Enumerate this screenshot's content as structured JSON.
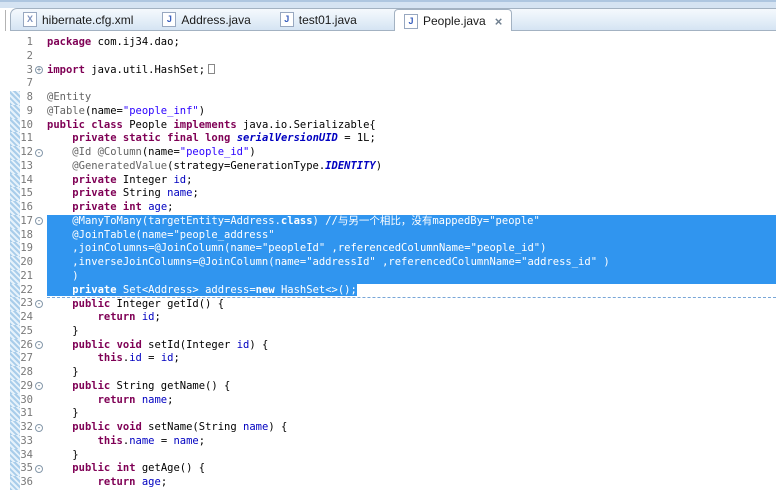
{
  "tabs": [
    {
      "label": "hibernate.cfg.xml",
      "icon": "xml-file-icon",
      "icon_letter": "X",
      "active": false
    },
    {
      "label": "Address.java",
      "icon": "java-file-icon",
      "icon_letter": "J",
      "active": false
    },
    {
      "label": "test01.java",
      "icon": "java-file-icon",
      "icon_letter": "J",
      "active": false
    },
    {
      "label": "People.java",
      "icon": "java-file-icon",
      "icon_letter": "J",
      "active": true,
      "close_glyph": "×"
    }
  ],
  "editor": {
    "colors": {
      "selection": "#3095ef",
      "keyword": "#7f0055",
      "annotation": "#646464",
      "string": "#2a00ff",
      "field": "#0000c0",
      "comment": "#3f7f5f",
      "line_number": "#787878"
    },
    "fold_glyphs": {
      "plus": "+",
      "minus": "-"
    },
    "lines": [
      {
        "n": "1",
        "fold": null,
        "sel": null,
        "tokens": [
          [
            "kw",
            "package"
          ],
          [
            "pl",
            " com.ij34.dao;"
          ]
        ]
      },
      {
        "n": "2",
        "fold": null,
        "sel": null,
        "tokens": []
      },
      {
        "n": "3",
        "fold": "plus",
        "sel": null,
        "tokens": [
          [
            "kw",
            "import"
          ],
          [
            "pl",
            " java.util.HashSet;"
          ],
          [
            "box",
            ""
          ]
        ]
      },
      {
        "n": "7",
        "fold": null,
        "sel": null,
        "tokens": []
      },
      {
        "n": "8",
        "fold": null,
        "sel": null,
        "tokens": [
          [
            "ann",
            "@Entity"
          ]
        ]
      },
      {
        "n": "9",
        "fold": null,
        "sel": null,
        "tokens": [
          [
            "ann",
            "@Table"
          ],
          [
            "pl",
            "(name="
          ],
          [
            "str",
            "\"people_inf\""
          ],
          [
            "pl",
            ")"
          ]
        ]
      },
      {
        "n": "10",
        "fold": null,
        "sel": null,
        "tokens": [
          [
            "kw",
            "public"
          ],
          [
            "pl",
            " "
          ],
          [
            "kw",
            "class"
          ],
          [
            "pl",
            " People "
          ],
          [
            "kw",
            "implements"
          ],
          [
            "pl",
            " java.io.Serializable{"
          ]
        ]
      },
      {
        "n": "11",
        "fold": null,
        "sel": null,
        "tokens": [
          [
            "pl",
            "    "
          ],
          [
            "kw",
            "private"
          ],
          [
            "pl",
            " "
          ],
          [
            "kw",
            "static"
          ],
          [
            "pl",
            " "
          ],
          [
            "kw",
            "final"
          ],
          [
            "pl",
            " "
          ],
          [
            "kw",
            "long"
          ],
          [
            "pl",
            " "
          ],
          [
            "sf",
            "serialVersionUID"
          ],
          [
            "pl",
            " = 1L;"
          ]
        ]
      },
      {
        "n": "12",
        "fold": "minus",
        "sel": null,
        "tokens": [
          [
            "pl",
            "    "
          ],
          [
            "ann",
            "@Id @Column"
          ],
          [
            "pl",
            "(name="
          ],
          [
            "str",
            "\"people_id\""
          ],
          [
            "pl",
            ")"
          ]
        ]
      },
      {
        "n": "13",
        "fold": null,
        "sel": null,
        "tokens": [
          [
            "pl",
            "    "
          ],
          [
            "ann",
            "@GeneratedValue"
          ],
          [
            "pl",
            "(strategy=GenerationType."
          ],
          [
            "sf",
            "IDENTITY"
          ],
          [
            "pl",
            ")"
          ]
        ]
      },
      {
        "n": "14",
        "fold": null,
        "sel": null,
        "tokens": [
          [
            "pl",
            "    "
          ],
          [
            "kw",
            "private"
          ],
          [
            "pl",
            " Integer "
          ],
          [
            "fld",
            "id"
          ],
          [
            "pl",
            ";"
          ]
        ]
      },
      {
        "n": "15",
        "fold": null,
        "sel": null,
        "tokens": [
          [
            "pl",
            "    "
          ],
          [
            "kw",
            "private"
          ],
          [
            "pl",
            " String "
          ],
          [
            "fld",
            "name"
          ],
          [
            "pl",
            ";"
          ]
        ]
      },
      {
        "n": "16",
        "fold": null,
        "sel": null,
        "tokens": [
          [
            "pl",
            "    "
          ],
          [
            "kw",
            "private"
          ],
          [
            "pl",
            " "
          ],
          [
            "kw",
            "int"
          ],
          [
            "pl",
            " "
          ],
          [
            "fld",
            "age"
          ],
          [
            "pl",
            ";"
          ]
        ]
      },
      {
        "n": "17",
        "fold": "minus",
        "sel": "full",
        "tokens": [
          [
            "pl",
            "    "
          ],
          [
            "ann",
            "@ManyToMany"
          ],
          [
            "pl",
            "(targetEntity=Address."
          ],
          [
            "kw",
            "class"
          ],
          [
            "pl",
            ") "
          ],
          [
            "cm",
            "//与另一个相比，没有mappedBy=\"people\""
          ]
        ]
      },
      {
        "n": "18",
        "fold": null,
        "sel": "full",
        "tokens": [
          [
            "pl",
            "    "
          ],
          [
            "ann",
            "@JoinTable"
          ],
          [
            "pl",
            "(name="
          ],
          [
            "str",
            "\"people_address\""
          ]
        ]
      },
      {
        "n": "19",
        "fold": null,
        "sel": "full",
        "tokens": [
          [
            "pl",
            "    ,joinColumns="
          ],
          [
            "ann",
            "@JoinColumn"
          ],
          [
            "pl",
            "(name="
          ],
          [
            "str",
            "\"peopleId\""
          ],
          [
            "pl",
            " ,referencedColumnName="
          ],
          [
            "str",
            "\"people_id\""
          ],
          [
            "pl",
            ")"
          ]
        ]
      },
      {
        "n": "20",
        "fold": null,
        "sel": "full",
        "tokens": [
          [
            "pl",
            "    ,inverseJoinColumns="
          ],
          [
            "ann",
            "@JoinColumn"
          ],
          [
            "pl",
            "(name="
          ],
          [
            "str",
            "\"addressId\""
          ],
          [
            "pl",
            " ,referencedColumnName="
          ],
          [
            "str",
            "\"address_id\""
          ],
          [
            "pl",
            " )"
          ]
        ]
      },
      {
        "n": "21",
        "fold": null,
        "sel": "full",
        "tokens": [
          [
            "pl",
            "    )"
          ]
        ]
      },
      {
        "n": "22",
        "fold": null,
        "sel": "text",
        "tokens": [
          [
            "pl",
            "    "
          ],
          [
            "kw",
            "private"
          ],
          [
            "pl",
            " Set<Address> "
          ],
          [
            "fld",
            "address"
          ],
          [
            "pl",
            "="
          ],
          [
            "kw",
            "new"
          ],
          [
            "pl",
            " HashSet<>();"
          ]
        ]
      },
      {
        "n": "23",
        "fold": "minus",
        "sel": null,
        "tokens": [
          [
            "pl",
            "    "
          ],
          [
            "kw",
            "public"
          ],
          [
            "pl",
            " Integer getId() {"
          ]
        ]
      },
      {
        "n": "24",
        "fold": null,
        "sel": null,
        "tokens": [
          [
            "pl",
            "        "
          ],
          [
            "kw",
            "return"
          ],
          [
            "pl",
            " "
          ],
          [
            "fld",
            "id"
          ],
          [
            "pl",
            ";"
          ]
        ]
      },
      {
        "n": "25",
        "fold": null,
        "sel": null,
        "tokens": [
          [
            "pl",
            "    }"
          ]
        ]
      },
      {
        "n": "26",
        "fold": "minus",
        "sel": null,
        "tokens": [
          [
            "pl",
            "    "
          ],
          [
            "kw",
            "public"
          ],
          [
            "pl",
            " "
          ],
          [
            "kw",
            "void"
          ],
          [
            "pl",
            " setId(Integer "
          ],
          [
            "fld",
            "id"
          ],
          [
            "pl",
            ") {"
          ]
        ]
      },
      {
        "n": "27",
        "fold": null,
        "sel": null,
        "tokens": [
          [
            "pl",
            "        "
          ],
          [
            "kw",
            "this"
          ],
          [
            "pl",
            "."
          ],
          [
            "fld",
            "id"
          ],
          [
            "pl",
            " = "
          ],
          [
            "fld",
            "id"
          ],
          [
            "pl",
            ";"
          ]
        ]
      },
      {
        "n": "28",
        "fold": null,
        "sel": null,
        "tokens": [
          [
            "pl",
            "    }"
          ]
        ]
      },
      {
        "n": "29",
        "fold": "minus",
        "sel": null,
        "tokens": [
          [
            "pl",
            "    "
          ],
          [
            "kw",
            "public"
          ],
          [
            "pl",
            " String getName() {"
          ]
        ]
      },
      {
        "n": "30",
        "fold": null,
        "sel": null,
        "tokens": [
          [
            "pl",
            "        "
          ],
          [
            "kw",
            "return"
          ],
          [
            "pl",
            " "
          ],
          [
            "fld",
            "name"
          ],
          [
            "pl",
            ";"
          ]
        ]
      },
      {
        "n": "31",
        "fold": null,
        "sel": null,
        "tokens": [
          [
            "pl",
            "    }"
          ]
        ]
      },
      {
        "n": "32",
        "fold": "minus",
        "sel": null,
        "tokens": [
          [
            "pl",
            "    "
          ],
          [
            "kw",
            "public"
          ],
          [
            "pl",
            " "
          ],
          [
            "kw",
            "void"
          ],
          [
            "pl",
            " setName(String "
          ],
          [
            "fld",
            "name"
          ],
          [
            "pl",
            ") {"
          ]
        ]
      },
      {
        "n": "33",
        "fold": null,
        "sel": null,
        "tokens": [
          [
            "pl",
            "        "
          ],
          [
            "kw",
            "this"
          ],
          [
            "pl",
            "."
          ],
          [
            "fld",
            "name"
          ],
          [
            "pl",
            " = "
          ],
          [
            "fld",
            "name"
          ],
          [
            "pl",
            ";"
          ]
        ]
      },
      {
        "n": "34",
        "fold": null,
        "sel": null,
        "tokens": [
          [
            "pl",
            "    }"
          ]
        ]
      },
      {
        "n": "35",
        "fold": "minus",
        "sel": null,
        "tokens": [
          [
            "pl",
            "    "
          ],
          [
            "kw",
            "public"
          ],
          [
            "pl",
            " "
          ],
          [
            "kw",
            "int"
          ],
          [
            "pl",
            " getAge() {"
          ]
        ]
      },
      {
        "n": "36",
        "fold": null,
        "sel": null,
        "tokens": [
          [
            "pl",
            "        "
          ],
          [
            "kw",
            "return"
          ],
          [
            "pl",
            " "
          ],
          [
            "fld",
            "age"
          ],
          [
            "pl",
            ";"
          ]
        ]
      }
    ]
  }
}
